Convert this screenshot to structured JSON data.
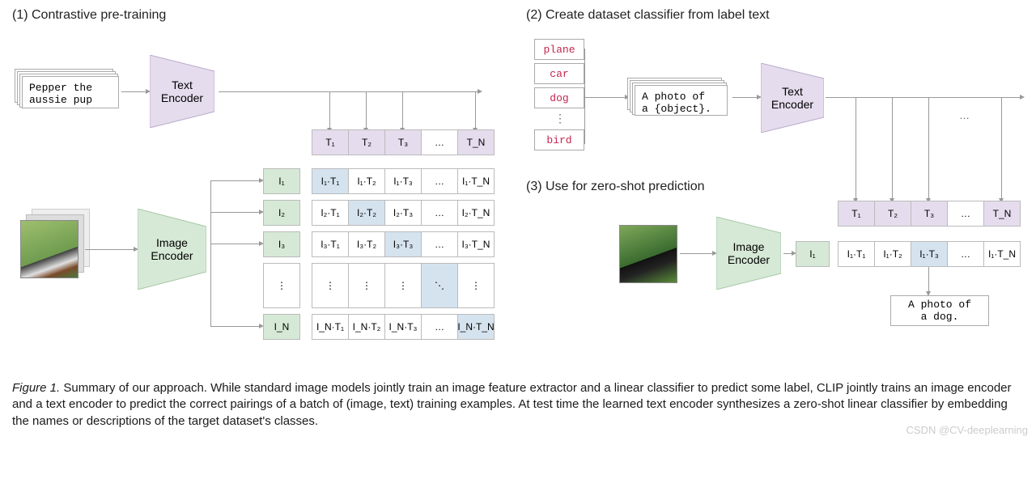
{
  "titles": {
    "t1": "(1) Contrastive pre-training",
    "t2": "(2) Create dataset classifier from label text",
    "t3": "(3) Use for zero-shot prediction"
  },
  "encoders": {
    "text": "Text\nEncoder",
    "image": "Image\nEncoder"
  },
  "inputs": {
    "text_example": "Pepper the\naussie pup",
    "prompt": "A photo of\na {object}.",
    "output": "A photo of\na dog."
  },
  "classes": {
    "c0": "plane",
    "c1": "car",
    "c2": "dog",
    "c3": "bird"
  },
  "tokens": {
    "T1": "T₁",
    "T2": "T₂",
    "T3": "T₃",
    "TN": "T_N",
    "I1": "I₁",
    "I2": "I₂",
    "I3": "I₃",
    "IN": "I_N"
  },
  "matrix": {
    "r1": {
      "c1": "I₁·T₁",
      "c2": "I₁·T₂",
      "c3": "I₁·T₃",
      "cN": "I₁·T_N"
    },
    "r2": {
      "c1": "I₂·T₁",
      "c2": "I₂·T₂",
      "c3": "I₂·T₃",
      "cN": "I₂·T_N"
    },
    "r3": {
      "c1": "I₃·T₁",
      "c2": "I₃·T₂",
      "c3": "I₃·T₃",
      "cN": "I₃·T_N"
    },
    "rN": {
      "c1": "I_N·T₁",
      "c2": "I_N·T₂",
      "c3": "I_N·T₃",
      "cN": "I_N·T_N"
    }
  },
  "ellipsis": "…",
  "dot_ellipsis": "⋱",
  "vdots": "⋮",
  "caption": {
    "label": "Figure 1.",
    "body": " Summary of our approach. While standard image models jointly train an image feature extractor and a linear classifier to predict some label, CLIP jointly trains an image encoder and a text encoder to predict the correct pairings of a batch of (image, text) training examples. At test time the learned text encoder synthesizes a zero-shot linear classifier by embedding the names or descriptions of the target dataset's classes."
  },
  "watermark": "CSDN @CV-deeplearning"
}
